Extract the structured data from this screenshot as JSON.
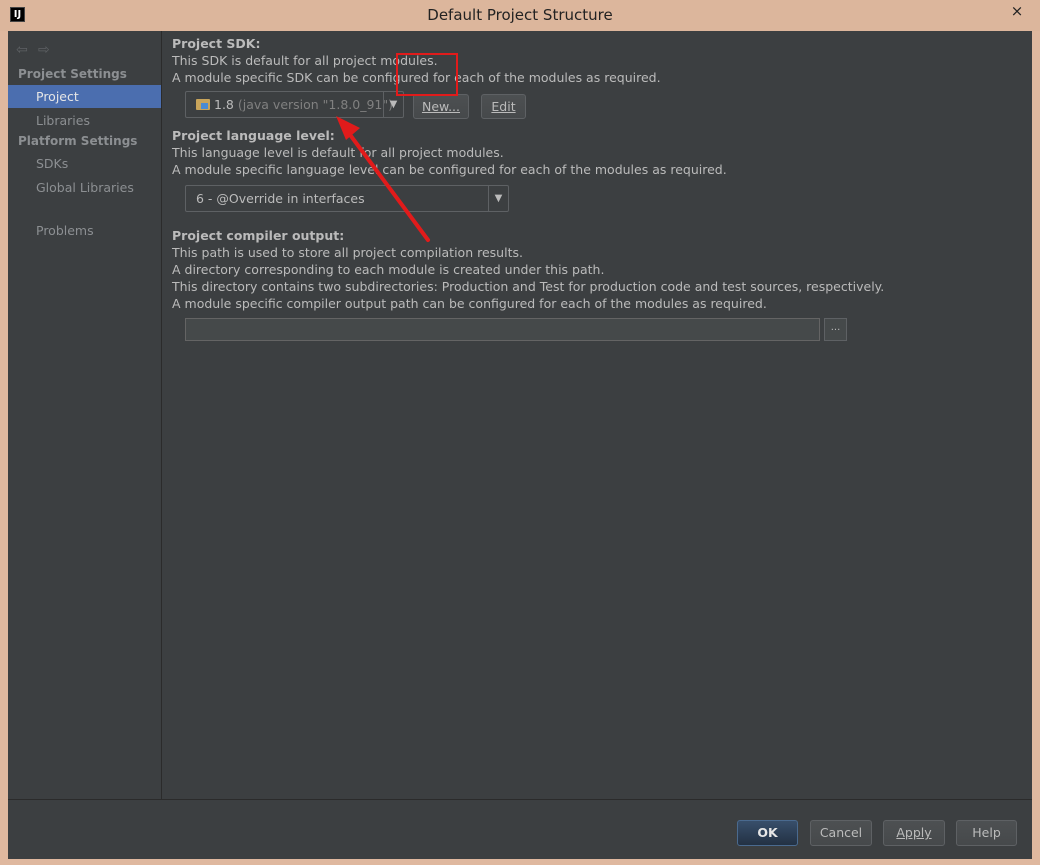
{
  "window": {
    "app_icon": "IJ",
    "title": "Default Project Structure",
    "close_glyph": "×"
  },
  "sidebar": {
    "nav_back_icon": "arrow-left-icon",
    "nav_forward_icon": "arrow-right-icon",
    "project_settings_header": "Project Settings",
    "platform_settings_header": "Platform Settings",
    "items": [
      {
        "label": "Project",
        "selected": true
      },
      {
        "label": "Libraries",
        "selected": false
      },
      {
        "label": "SDKs",
        "selected": false
      },
      {
        "label": "Global Libraries",
        "selected": false
      },
      {
        "label": "Problems",
        "selected": false
      }
    ]
  },
  "sdk": {
    "heading": "Project SDK:",
    "line1": "This SDK is default for all project modules.",
    "line2": "A module specific SDK can be configured for each of the modules as required.",
    "selected_version": "1.8",
    "selected_hint": "(java version \"1.8.0_91\")",
    "new_button": "New...",
    "edit_button": "Edit"
  },
  "language": {
    "heading": "Project language level:",
    "line1": "This language level is default for all project modules.",
    "line2": "A module specific language level can be configured for each of the modules as required.",
    "selected": "6 - @Override in interfaces"
  },
  "compiler": {
    "heading": "Project compiler output:",
    "line1": "This path is used to store all project compilation results.",
    "line2": "A directory corresponding to each module is created under this path.",
    "line3": "This directory contains two subdirectories: Production and Test for production code and test sources, respectively.",
    "line4": "A module specific compiler output path can be configured for each of the modules as required.",
    "path_value": "",
    "browse_label": "..."
  },
  "dialog_buttons": {
    "ok": "OK",
    "cancel": "Cancel",
    "apply": "Apply",
    "help": "Help"
  },
  "annotation_color": "#e11b1b"
}
